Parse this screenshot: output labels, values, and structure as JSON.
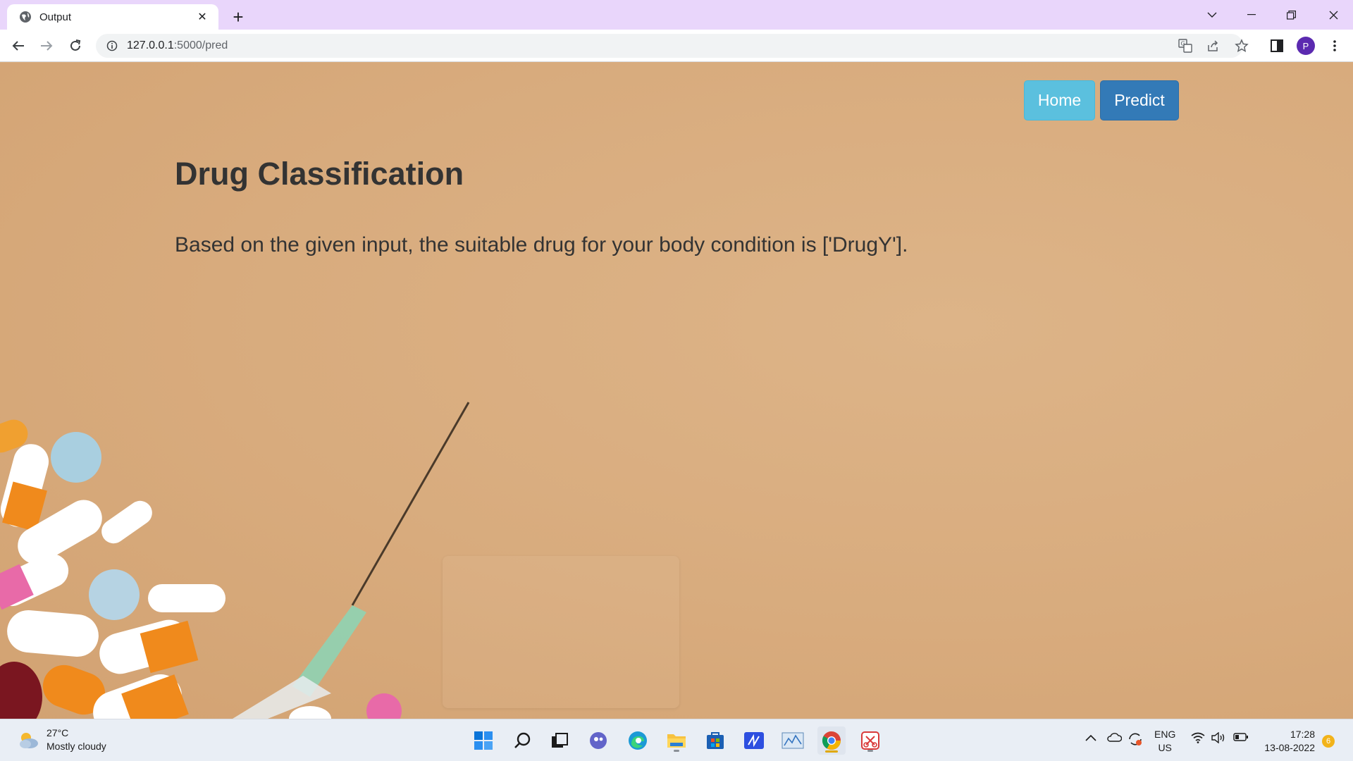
{
  "browser": {
    "tab_title": "Output",
    "url_host": "127.0.0.1",
    "url_rest": ":5000/pred",
    "profile_initial": "P"
  },
  "nav": {
    "home_label": "Home",
    "predict_label": "Predict"
  },
  "content": {
    "heading": "Drug Classification",
    "result_text": "Based on the given input, the suitable drug for your body condition is ['DrugY']."
  },
  "taskbar": {
    "weather_temp": "27°C",
    "weather_desc": "Mostly cloudy",
    "lang_top": "ENG",
    "lang_bottom": "US",
    "time": "17:28",
    "date": "13-08-2022",
    "notification_count": "6"
  },
  "colors": {
    "page_bg": "#d8ad80",
    "home_button": "#5bc0de",
    "predict_button": "#337ab7",
    "tab_strip": "#e9d6fb"
  }
}
